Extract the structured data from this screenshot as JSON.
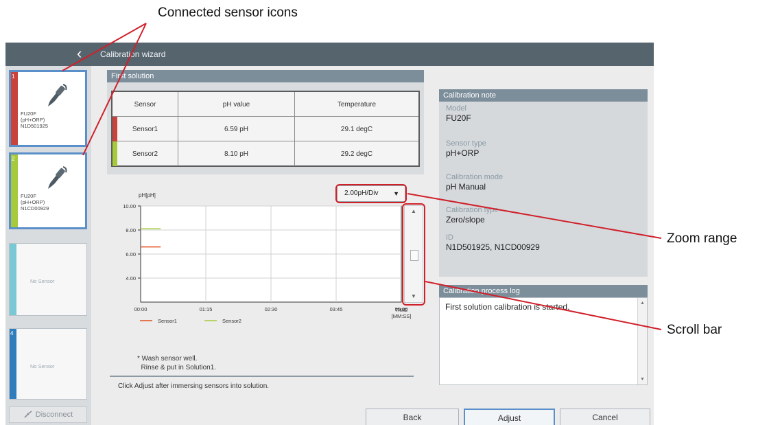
{
  "annotations": {
    "connected_sensor_icons": "Connected sensor icons",
    "zoom_range": "Zoom range",
    "scroll_bar": "Scroll bar"
  },
  "titlebar": {
    "title": "Calibration wizard",
    "back_icon": "chevron-left-icon"
  },
  "sensor_rail": {
    "slots": [
      {
        "number": "1",
        "text": "FU20F\n(pH+ORP)\nN1D501925",
        "color": "#c9433d",
        "connected": true
      },
      {
        "number": "2",
        "text": "FU20F\n(pH+ORP)\nN1CD00929",
        "color": "#a7c93c",
        "connected": true
      },
      {
        "number": "",
        "text": "No Sensor",
        "color": "#79c8d6",
        "connected": false
      },
      {
        "number": "4",
        "text": "No Sensor",
        "color": "#2f7dbc",
        "connected": false
      }
    ],
    "disconnect_label": "Disconnect"
  },
  "first_solution": {
    "title": "First solution",
    "headers": [
      "Sensor",
      "pH value",
      "Temperature"
    ],
    "rows": [
      {
        "sensor": "Sensor1",
        "ph": "6.59 pH",
        "temperature": "29.1 degC",
        "color": "#c9433d"
      },
      {
        "sensor": "Sensor2",
        "ph": "8.10 pH",
        "temperature": "29.2 degC",
        "color": "#a7c93c"
      }
    ]
  },
  "zoom": {
    "selected": "2.00pH/Div"
  },
  "chart": {
    "y_label": "pH[pH]",
    "y_ticks": [
      "10.00",
      "8.00",
      "6.00",
      "4.00"
    ],
    "x_ticks": [
      "00:00",
      "01:15",
      "02:30",
      "03:45",
      "05:00"
    ],
    "x_axis_label_1": "TIME",
    "x_axis_label_2": "[MM:SS]",
    "legend": [
      "Sensor1",
      "Sensor2"
    ]
  },
  "chart_data": {
    "type": "line",
    "ylabel": "pH[pH]",
    "xlabel": "TIME [MM:SS]",
    "x_ticks": [
      "00:00",
      "01:15",
      "02:30",
      "03:45",
      "05:00"
    ],
    "ylim": [
      2.0,
      10.0
    ],
    "series": [
      {
        "name": "Sensor1",
        "color": "#e1501f",
        "points": [
          [
            "00:00",
            6.59
          ],
          [
            "00:23",
            6.59
          ]
        ]
      },
      {
        "name": "Sensor2",
        "color": "#a7c93c",
        "points": [
          [
            "00:00",
            8.1
          ],
          [
            "00:23",
            8.1
          ]
        ]
      }
    ],
    "grid": true
  },
  "instructions": {
    "wash": "* Wash sensor well.\n  Rinse & put in Solution1.",
    "click": "Click Adjust after immersing sensors into solution."
  },
  "calibration_note": {
    "title": "Calibration note",
    "fields": [
      {
        "label": "Model",
        "value": "FU20F"
      },
      {
        "label": "Sensor type",
        "value": "pH+ORP"
      },
      {
        "label": "Calibration mode",
        "value": "pH Manual"
      },
      {
        "label": "Calibration type",
        "value": "Zero/slope"
      },
      {
        "label": "ID",
        "value": "N1D501925, N1CD00929"
      }
    ]
  },
  "process_log": {
    "title": "Calibration process log",
    "entries": [
      "First solution calibration is started."
    ]
  },
  "footer": {
    "back": "Back",
    "adjust": "Adjust",
    "cancel": "Cancel"
  },
  "colors": {
    "titlebar": "#56646e",
    "panel_header": "#7d8e9b",
    "annotation_red": "#d0202a",
    "active_border": "#5b8fc9"
  }
}
